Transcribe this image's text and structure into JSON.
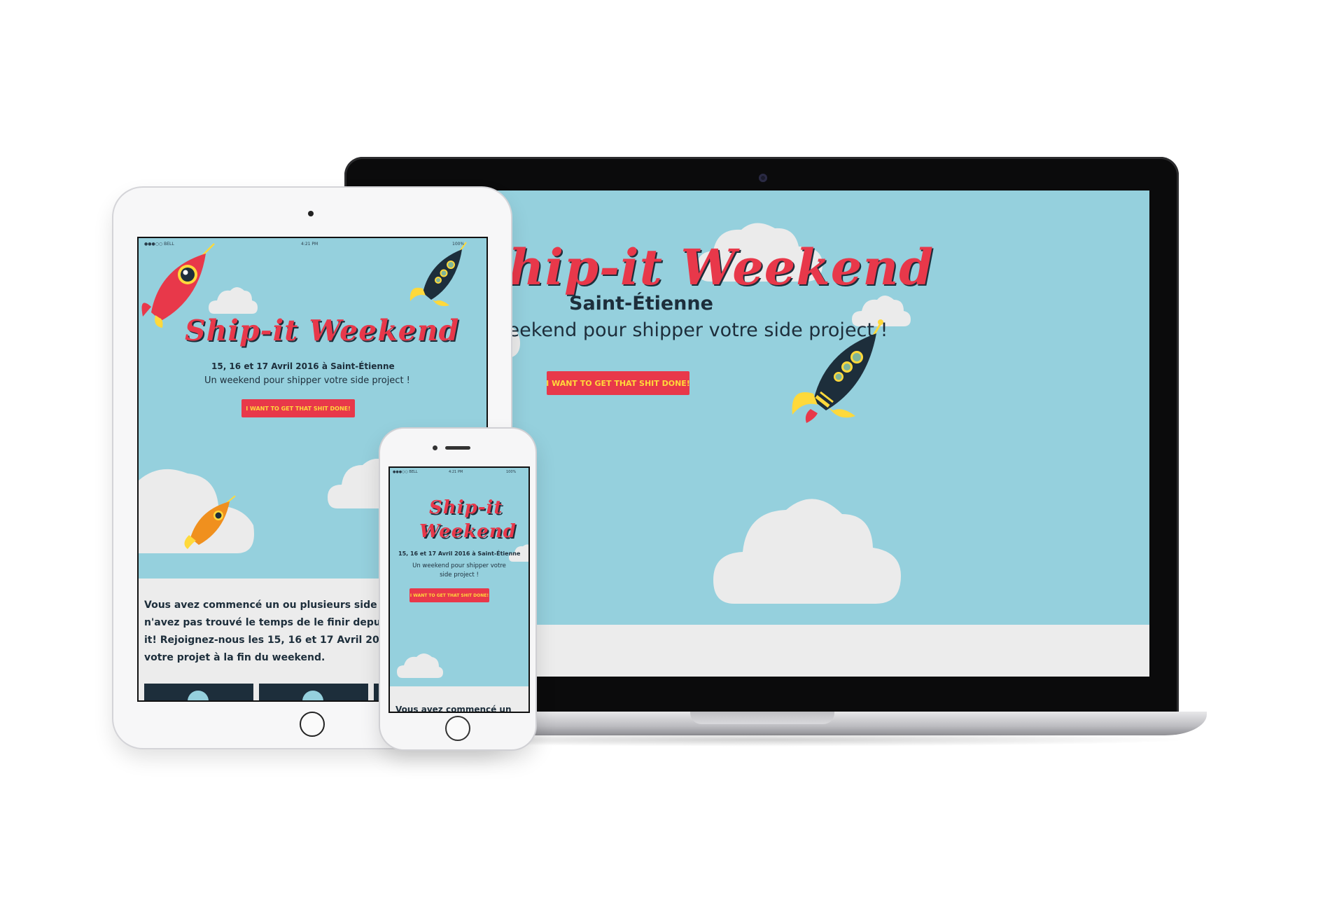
{
  "event": {
    "title": "Ship-it Weekend",
    "title_line1": "Ship-it",
    "title_line2": "Weekend",
    "city": "Saint-Étienne",
    "dates": "15, 16 et 17 Avril 2016 à Saint-Étienne",
    "tagline": "Un weekend pour shipper votre side project !",
    "cta": "I want to get that shit done!"
  },
  "status_bar": {
    "carrier": "●●●○○ BELL",
    "time": "4:21 PM",
    "battery": "100%"
  },
  "tablet_intro": {
    "lines": [
      "Vous avez commencé un ou plusieurs side pr",
      "n'avez pas trouvé le temps de le finir depuis",
      "it! Rejoignez-nous les 15, 16 et 17 Avril 2016.",
      "votre projet à la fin du weekend."
    ]
  },
  "phone_intro": {
    "partial": "Vous avez commencé un"
  },
  "colors": {
    "sky": "#95d0dd",
    "accent_red": "#e8384a",
    "button_text": "#ffd93b",
    "navy": "#1d2e3b",
    "cloud": "#ebebeb",
    "rocket_orange": "#f0901e"
  },
  "icons": [
    "rocket-red-icon",
    "rocket-navy-icon",
    "rocket-orange-icon",
    "cloud-icon"
  ]
}
